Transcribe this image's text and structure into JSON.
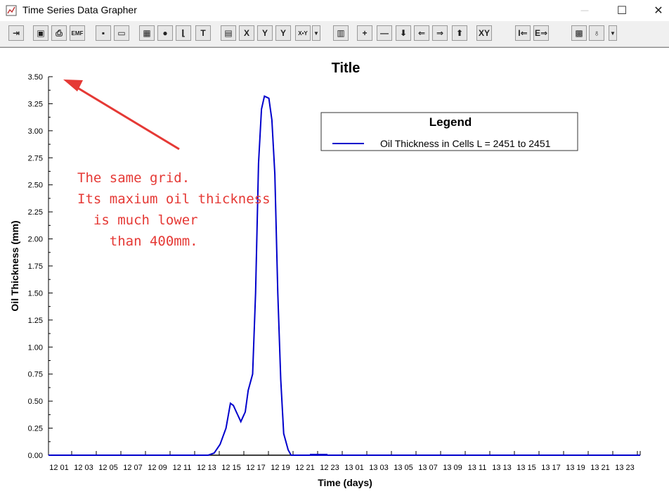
{
  "window": {
    "title": "Time Series Data Grapher",
    "minimize_glyph": "—",
    "maximize_glyph": "☐",
    "close_glyph": "✕"
  },
  "toolbar": {
    "buttons": [
      {
        "name": "exit-button",
        "icon": "exit-door-icon",
        "glyph": "⇥"
      },
      {
        "name": "copy-bitmap-button",
        "icon": "copy-icon",
        "glyph": "▣"
      },
      {
        "name": "print-button",
        "icon": "printer-icon",
        "glyph": "⎙"
      },
      {
        "name": "export-emf-button",
        "icon": "emf-export-icon",
        "glyph": "EMF"
      },
      {
        "name": "save-button",
        "icon": "floppy-disk-icon",
        "glyph": "▪"
      },
      {
        "name": "open-button",
        "icon": "folder-icon",
        "glyph": "▭"
      },
      {
        "name": "grid-button",
        "icon": "grid-icon",
        "glyph": "▦"
      },
      {
        "name": "fill-button",
        "icon": "paint-icon",
        "glyph": "●"
      },
      {
        "name": "axes-button",
        "icon": "axes-icon",
        "glyph": "⌊"
      },
      {
        "name": "text-button",
        "icon": "text-icon",
        "glyph": "T"
      },
      {
        "name": "series-button",
        "icon": "series-icon",
        "glyph": "▤"
      },
      {
        "name": "x-axis-button",
        "icon": "x-axis-icon",
        "glyph": "X"
      },
      {
        "name": "y-axis-button",
        "icon": "y-axis-icon",
        "glyph": "Y"
      },
      {
        "name": "y2-axis-button",
        "icon": "y2-axis-icon",
        "glyph": "Y"
      },
      {
        "name": "xy-button",
        "icon": "xy-icon",
        "glyph": "X•Y"
      },
      {
        "name": "legend-button",
        "icon": "legend-icon",
        "glyph": "▥"
      },
      {
        "name": "zoom-in-button",
        "icon": "plus-icon",
        "glyph": "+"
      },
      {
        "name": "zoom-out-button",
        "icon": "minus-icon",
        "glyph": "—"
      },
      {
        "name": "pan-down-button",
        "icon": "arrow-down-icon",
        "glyph": "⬇"
      },
      {
        "name": "pan-left-button",
        "icon": "arrow-left-icon",
        "glyph": "⇐"
      },
      {
        "name": "pan-right-button",
        "icon": "arrow-right-icon",
        "glyph": "⇒"
      },
      {
        "name": "pan-up-button",
        "icon": "arrow-up-icon",
        "glyph": "⬆"
      },
      {
        "name": "xy-reset-button",
        "icon": "xy-reset-icon",
        "glyph": "XY"
      },
      {
        "name": "start-button",
        "icon": "start-bracket-icon",
        "glyph": "I⇐"
      },
      {
        "name": "end-button",
        "icon": "end-bracket-icon",
        "glyph": "E⇒"
      },
      {
        "name": "background-button",
        "icon": "background-icon",
        "glyph": "▩"
      },
      {
        "name": "marker-button",
        "icon": "marker-icon",
        "glyph": "♁"
      }
    ]
  },
  "annotation": {
    "lines": [
      "The same grid.",
      "Its maxium oil thickness",
      "  is much lower",
      "    than 400mm."
    ],
    "color": "#e53935"
  },
  "chart_data": {
    "type": "line",
    "title": "Title",
    "xlabel": "Time (days)",
    "ylabel": "Oil Thickness (mm)",
    "ylim": [
      0,
      3.5
    ],
    "yticks": [
      "0.00",
      "0.25",
      "0.50",
      "0.75",
      "1.00",
      "1.25",
      "1.50",
      "1.75",
      "2.00",
      "2.25",
      "2.50",
      "2.75",
      "3.00",
      "3.25",
      "3.50"
    ],
    "xticks": [
      "12 01",
      "12 03",
      "12 05",
      "12 07",
      "12 09",
      "12 11",
      "12 13",
      "12 15",
      "12 17",
      "12 19",
      "12 21",
      "12 23",
      "13 01",
      "13 03",
      "13 05",
      "13 07",
      "13 09",
      "13 11",
      "13 13",
      "13 15",
      "13 17",
      "13 19",
      "13 21",
      "13 23"
    ],
    "xlim": [
      12.0,
      14.0
    ],
    "legend": {
      "title": "Legend",
      "placement": "top-right"
    },
    "grid": false,
    "series": [
      {
        "name": "Oil Thickness in Cells L =  2451 to  2451",
        "color": "#0000cc",
        "x": [
          12.0,
          12.54,
          12.56,
          12.58,
          12.6,
          12.615,
          12.625,
          12.635,
          12.65,
          12.665,
          12.675,
          12.69,
          12.7,
          12.71,
          12.72,
          12.73,
          12.745,
          12.755,
          12.765,
          12.775,
          12.785,
          12.795,
          12.81,
          12.82,
          12.83,
          12.845,
          12.86,
          12.88,
          13.0,
          14.0
        ],
        "y": [
          0,
          0,
          0.02,
          0.1,
          0.25,
          0.48,
          0.46,
          0.4,
          0.31,
          0.4,
          0.6,
          0.75,
          1.5,
          2.7,
          3.2,
          3.32,
          3.3,
          3.1,
          2.6,
          1.5,
          0.7,
          0.2,
          0.05,
          0.0,
          0,
          0,
          0,
          0,
          0,
          0
        ]
      },
      {
        "name": "",
        "color": "#000000",
        "x": [
          12.0,
          12.7,
          14.0
        ],
        "y": [
          0,
          0,
          0
        ]
      }
    ]
  }
}
